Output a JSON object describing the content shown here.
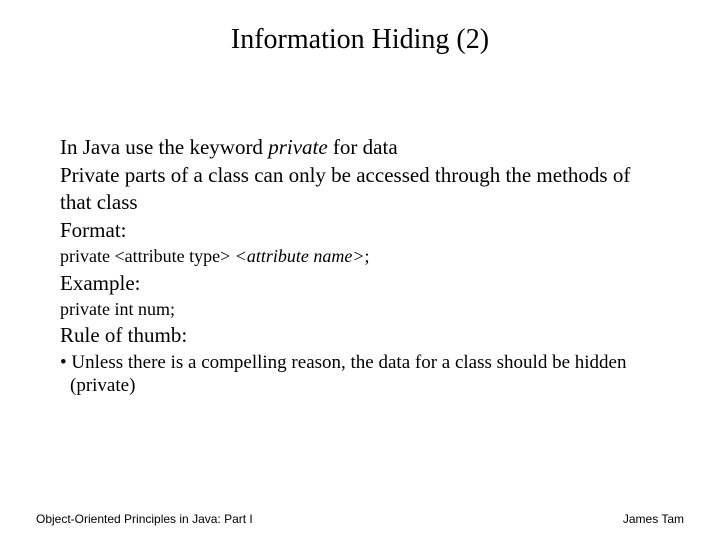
{
  "title": "Information Hiding (2)",
  "body": {
    "p1a": "In Java use the keyword ",
    "p1_kw": "private",
    "p1b": " for data",
    "p2": "Private parts of a class can only be accessed through the methods of that class",
    "format_label": "Format:",
    "format_line_a": "private <attribute type> ",
    "format_line_kw": "<attribute name>",
    "format_line_b": ";",
    "example_label": "Example:",
    "example_line": "private int num;",
    "rule_label": "Rule of thumb:",
    "rule_bullet": "• Unless there is a compelling reason, the data for  a class should be hidden (private)"
  },
  "footer": {
    "left": "Object-Oriented Principles in Java: Part I",
    "right": "James Tam"
  }
}
